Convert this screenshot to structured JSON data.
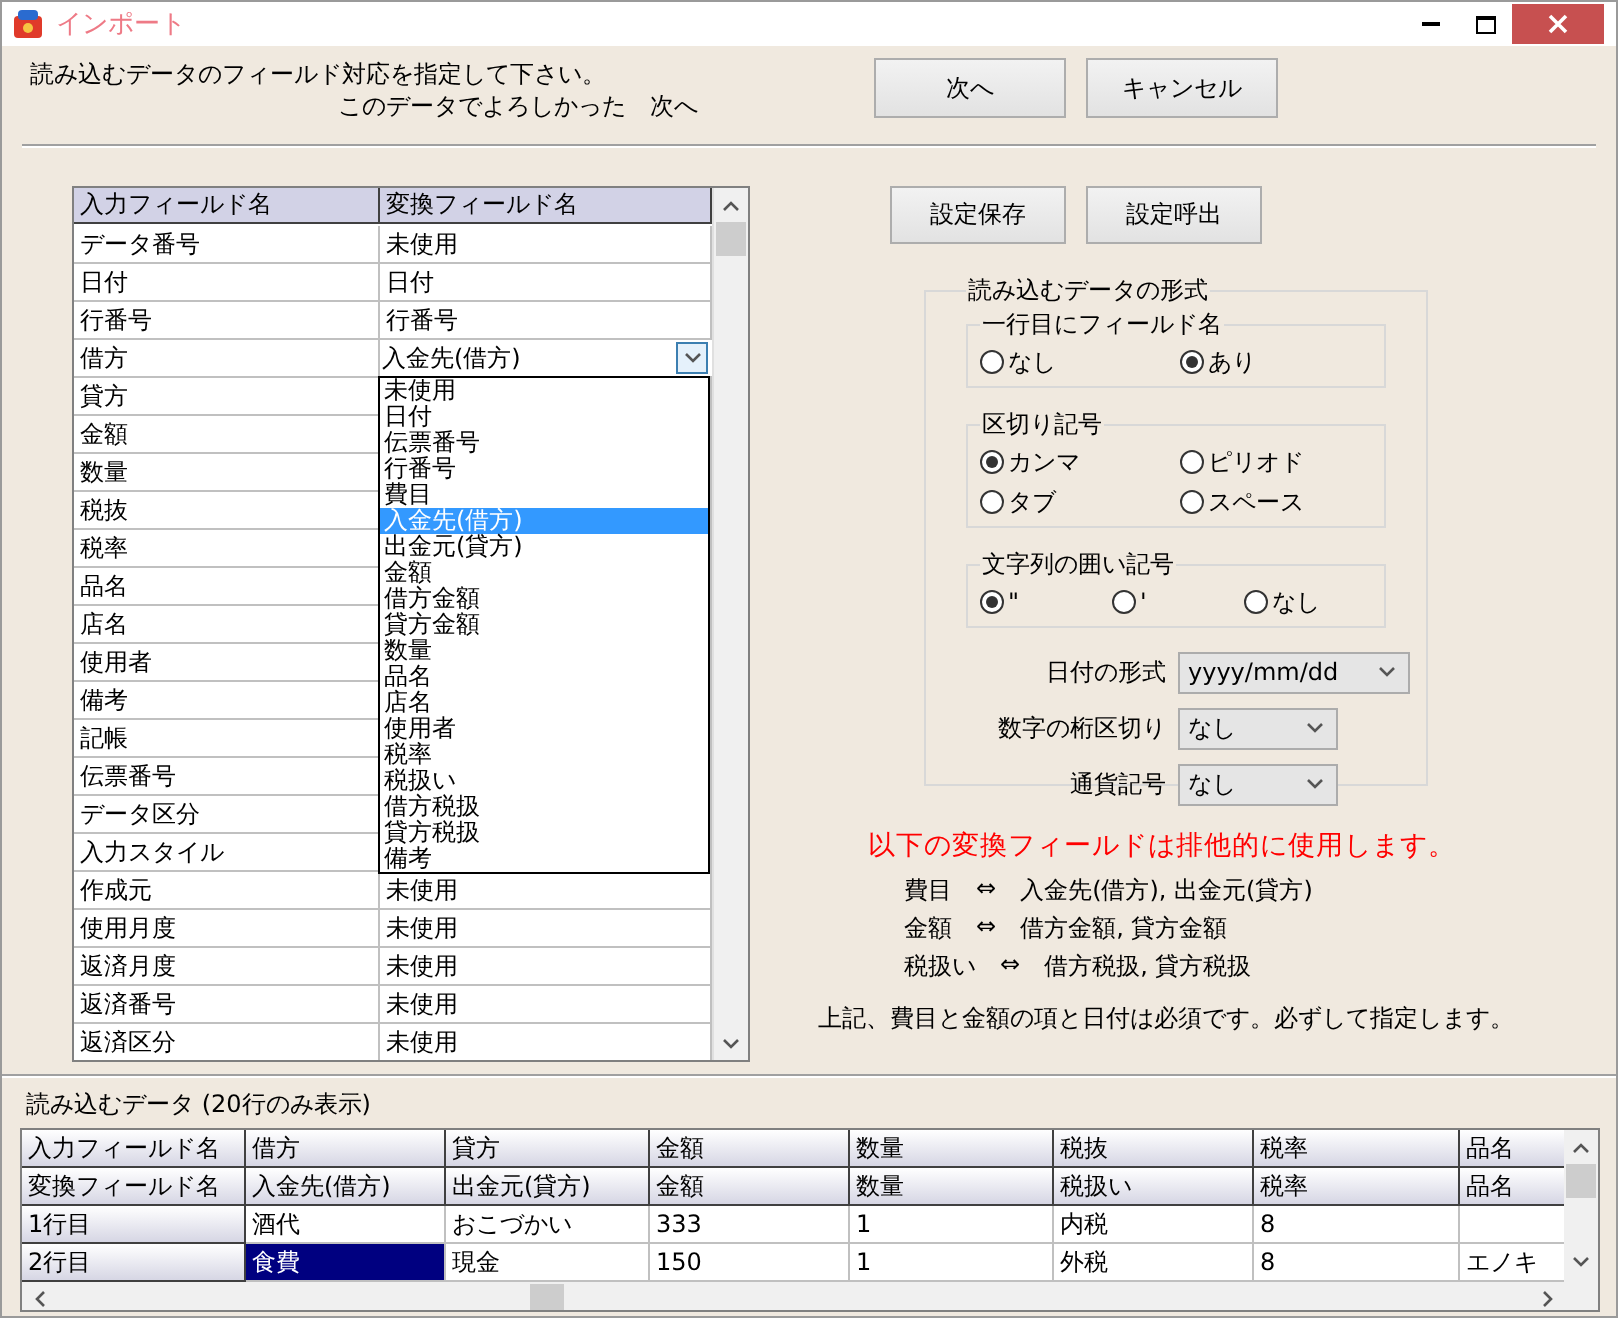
{
  "window": {
    "title": "インポート"
  },
  "instructions": [
    "読み込むデータのフィールド対応を指定して下さい。",
    "このデータでよろしかった　次へ"
  ],
  "buttons": [
    {
      "label": "次へ"
    },
    {
      "label": "キャンセル"
    }
  ],
  "field_grid": {
    "columns": [
      "入力フィールド名",
      "変換フィールド名"
    ],
    "rows": [
      {
        "input": "データ番号",
        "convert": "未使用"
      },
      {
        "input": "日付",
        "convert": "日付"
      },
      {
        "input": "行番号",
        "convert": "行番号"
      },
      {
        "input": "借方",
        "convert": "入金先(借方)",
        "kind": "editing"
      },
      {
        "input": "貸方"
      },
      {
        "input": "金額"
      },
      {
        "input": "数量"
      },
      {
        "input": "税抜"
      },
      {
        "input": "税率"
      },
      {
        "input": "品名"
      },
      {
        "input": "店名"
      },
      {
        "input": "使用者"
      },
      {
        "input": "備考"
      },
      {
        "input": "記帳"
      },
      {
        "input": "伝票番号"
      },
      {
        "input": "データ区分"
      },
      {
        "input": "入力スタイル"
      },
      {
        "input": "作成元",
        "convert": "未使用"
      },
      {
        "input": "使用月度",
        "convert": "未使用"
      },
      {
        "input": "返済月度",
        "convert": "未使用"
      },
      {
        "input": "返済番号",
        "convert": "未使用"
      },
      {
        "input": "返済区分",
        "convert": "未使用"
      }
    ],
    "dropdown": [
      {
        "label": "未使用",
        "selected": false
      },
      {
        "label": "日付",
        "selected": false
      },
      {
        "label": "伝票番号",
        "selected": false
      },
      {
        "label": "行番号",
        "selected": false
      },
      {
        "label": "費目",
        "selected": false
      },
      {
        "label": "入金先(借方)",
        "selected": true
      },
      {
        "label": "出金元(貸方)",
        "selected": false
      },
      {
        "label": "金額",
        "selected": false
      },
      {
        "label": "借方金額",
        "selected": false
      },
      {
        "label": "貸方金額",
        "selected": false
      },
      {
        "label": "数量",
        "selected": false
      },
      {
        "label": "品名",
        "selected": false
      },
      {
        "label": "店名",
        "selected": false
      },
      {
        "label": "使用者",
        "selected": false
      },
      {
        "label": "税率",
        "selected": false
      },
      {
        "label": "税扱い",
        "selected": false
      },
      {
        "label": "借方税扱",
        "selected": false
      },
      {
        "label": "貸方税扱",
        "selected": false
      },
      {
        "label": "備考",
        "selected": false
      }
    ]
  },
  "settings_buttons": [
    {
      "label": "設定保存"
    },
    {
      "label": "設定呼出"
    }
  ],
  "format": {
    "title": "読み込むデータの形式",
    "groups": [
      {
        "title": "一行目にフィールド名",
        "rows": [
          [
            {
              "label": "なし",
              "selected": false
            },
            {
              "label": "あり",
              "selected": true
            }
          ]
        ]
      },
      {
        "title": "区切り記号",
        "rows": [
          [
            {
              "label": "カンマ",
              "selected": true
            },
            {
              "label": "ピリオド",
              "selected": false
            }
          ],
          [
            {
              "label": "タブ",
              "selected": false
            },
            {
              "label": "スペース",
              "selected": false
            }
          ]
        ]
      },
      {
        "title": "文字列の囲い記号",
        "rows": [
          [
            {
              "label": "\"",
              "selected": true
            },
            {
              "label": "'",
              "selected": false
            },
            {
              "label": "なし",
              "selected": false
            }
          ]
        ]
      }
    ],
    "selects": [
      {
        "label": "日付の形式",
        "value": "yyyy/mm/dd",
        "kind": "wide"
      },
      {
        "label": "数字の桁区切り",
        "value": "なし",
        "kind": "narrow"
      },
      {
        "label": "通貨記号",
        "value": "なし",
        "kind": "narrow"
      }
    ]
  },
  "notice": {
    "heading": "以下の変換フィールドは排他的に使用します。",
    "rules": [
      {
        "field": "費目",
        "symbol": "⇔",
        "targets": "入金先(借方), 出金元(貸方)"
      },
      {
        "field": "金額",
        "symbol": "⇔",
        "targets": "借方金額, 貸方金額"
      },
      {
        "field": "税扱い",
        "symbol": "⇔",
        "targets": "借方税扱, 貸方税扱"
      }
    ],
    "note": "上記、費目と金額の項と日付は必須です。必ずして指定します。"
  },
  "preview": {
    "title": "読み込むデータ (20行のみ表示)",
    "header_rows": [
      {
        "label": "入力フィールド名",
        "cells": [
          "借方",
          "貸方",
          "金額",
          "数量",
          "税抜",
          "税率",
          "品名"
        ]
      },
      {
        "label": "変換フィールド名",
        "cells": [
          "入金先(借方)",
          "出金元(貸方)",
          "金額",
          "数量",
          "税扱い",
          "税率",
          "品名"
        ]
      }
    ],
    "rows": [
      {
        "label": "1行目",
        "cells": [
          {
            "text": "酒代",
            "selected": false
          },
          {
            "text": "おこづかい",
            "selected": false
          },
          {
            "text": "333",
            "selected": false
          },
          {
            "text": "1",
            "selected": false
          },
          {
            "text": "内税",
            "selected": false
          },
          {
            "text": "8",
            "selected": false
          }
        ]
      },
      {
        "label": "2行目",
        "cells": [
          {
            "text": "食費",
            "selected": true
          },
          {
            "text": "現金",
            "selected": false
          },
          {
            "text": "150",
            "selected": false
          },
          {
            "text": "1",
            "selected": false
          },
          {
            "text": "外税",
            "selected": false
          },
          {
            "text": "8",
            "selected": false
          },
          {
            "text": "エノキ",
            "selected": false
          }
        ]
      }
    ]
  }
}
